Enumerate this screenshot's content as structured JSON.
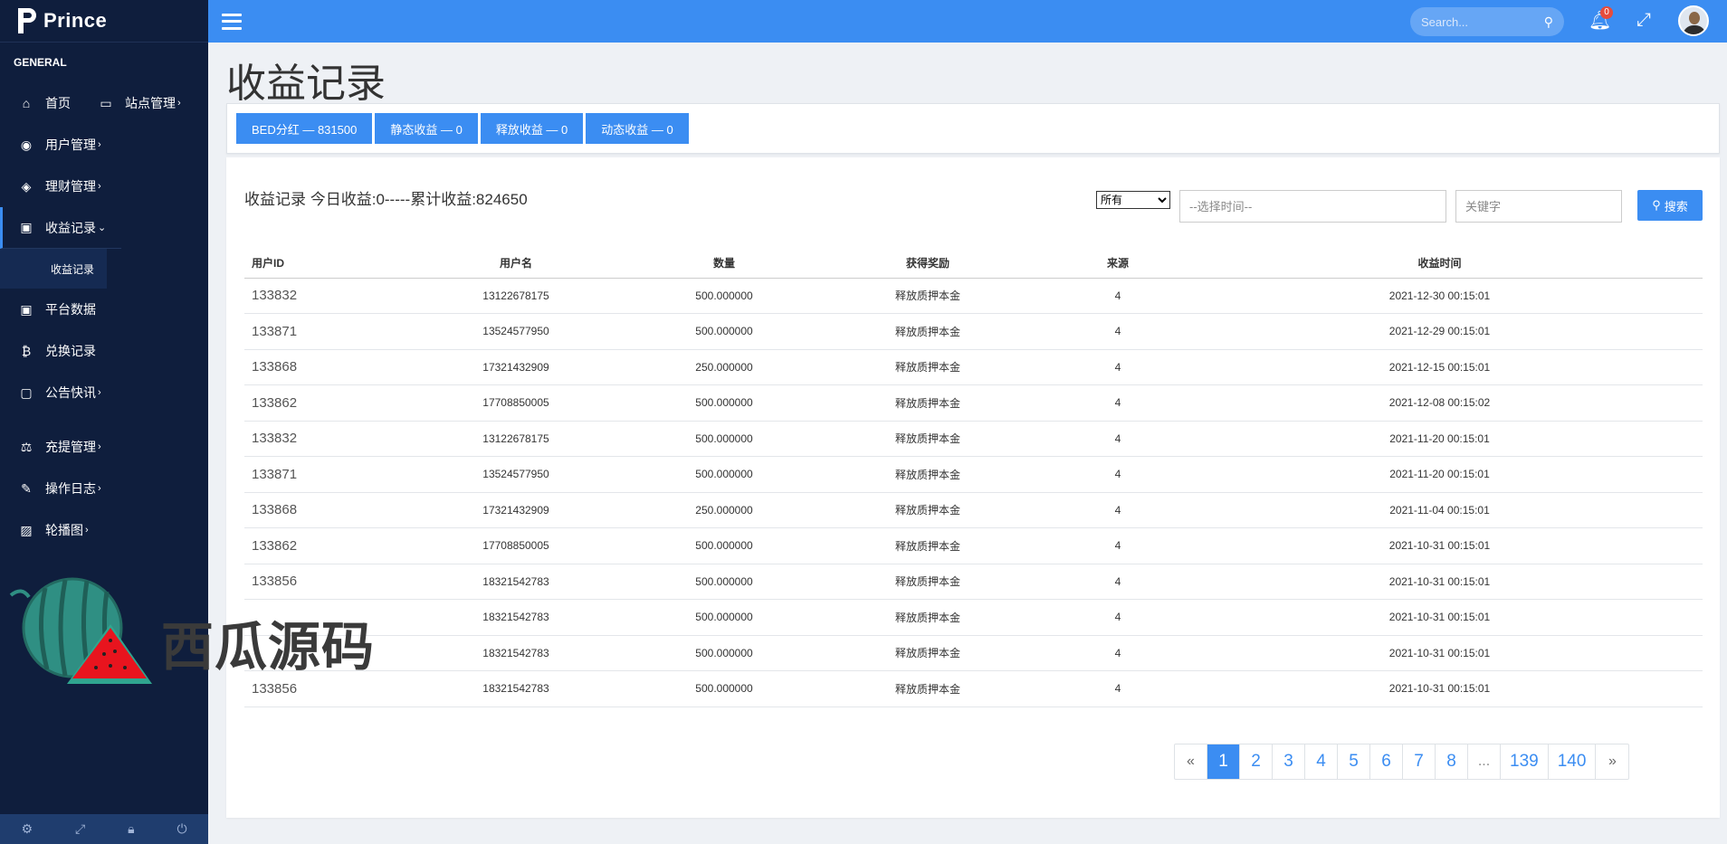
{
  "brand": {
    "name": "Prince"
  },
  "sidebar": {
    "section": "GENERAL",
    "items": [
      {
        "label": "首页",
        "icon": "home-icon"
      },
      {
        "label": "站点管理",
        "icon": "monitor-icon"
      },
      {
        "label": "用户管理",
        "icon": "user-circle-icon"
      },
      {
        "label": "理财管理",
        "icon": "cube-icon"
      },
      {
        "label": "收益记录",
        "icon": "money-icon"
      },
      {
        "label": "收益记录"
      },
      {
        "label": "平台数据",
        "icon": "money-icon"
      },
      {
        "label": "兑换记录",
        "icon": "bitcoin-icon"
      },
      {
        "label": "公告快讯",
        "icon": "window-icon"
      },
      {
        "label": "充提管理",
        "icon": "balance-scale-icon"
      },
      {
        "label": "操作日志",
        "icon": "edit-icon"
      },
      {
        "label": "轮播图",
        "icon": "image-icon"
      }
    ]
  },
  "watermark": {
    "text": "西瓜源码"
  },
  "topbar": {
    "search_placeholder": "Search...",
    "notification_count": "0"
  },
  "page": {
    "title": "收益记录"
  },
  "stats": [
    {
      "label": "BED分红 — 831500"
    },
    {
      "label": "静态收益 — 0"
    },
    {
      "label": "释放收益 — 0"
    },
    {
      "label": "动态收益 — 0"
    }
  ],
  "card": {
    "title": "收益记录 今日收益:0-----累计收益:824650",
    "filter_selected": "所有",
    "time_placeholder": "--选择时间--",
    "keyword_placeholder": "关键字",
    "search_label": "搜索"
  },
  "table": {
    "headers": [
      "用户ID",
      "用户名",
      "数量",
      "获得奖励",
      "来源",
      "收益时间"
    ],
    "rows": [
      [
        "133832",
        "13122678175",
        "500.000000",
        "释放质押本金",
        "4",
        "2021-12-30 00:15:01"
      ],
      [
        "133871",
        "13524577950",
        "500.000000",
        "释放质押本金",
        "4",
        "2021-12-29 00:15:01"
      ],
      [
        "133868",
        "17321432909",
        "250.000000",
        "释放质押本金",
        "4",
        "2021-12-15 00:15:01"
      ],
      [
        "133862",
        "17708850005",
        "500.000000",
        "释放质押本金",
        "4",
        "2021-12-08 00:15:02"
      ],
      [
        "133832",
        "13122678175",
        "500.000000",
        "释放质押本金",
        "4",
        "2021-11-20 00:15:01"
      ],
      [
        "133871",
        "13524577950",
        "500.000000",
        "释放质押本金",
        "4",
        "2021-11-20 00:15:01"
      ],
      [
        "133868",
        "17321432909",
        "250.000000",
        "释放质押本金",
        "4",
        "2021-11-04 00:15:01"
      ],
      [
        "133862",
        "17708850005",
        "500.000000",
        "释放质押本金",
        "4",
        "2021-10-31 00:15:01"
      ],
      [
        "133856",
        "18321542783",
        "500.000000",
        "释放质押本金",
        "4",
        "2021-10-31 00:15:01"
      ],
      [
        "",
        "18321542783",
        "500.000000",
        "释放质押本金",
        "4",
        "2021-10-31 00:15:01"
      ],
      [
        "",
        "18321542783",
        "500.000000",
        "释放质押本金",
        "4",
        "2021-10-31 00:15:01"
      ],
      [
        "133856",
        "18321542783",
        "500.000000",
        "释放质押本金",
        "4",
        "2021-10-31 00:15:01"
      ]
    ]
  },
  "pagination": {
    "prev": "«",
    "pages": [
      "1",
      "2",
      "3",
      "4",
      "5",
      "6",
      "7",
      "8",
      "...",
      "139",
      "140"
    ],
    "next": "»",
    "current": "1"
  },
  "colors": {
    "accent": "#3b8df2",
    "sidebar": "#0f1e3d",
    "badge": "#e74c3c"
  }
}
